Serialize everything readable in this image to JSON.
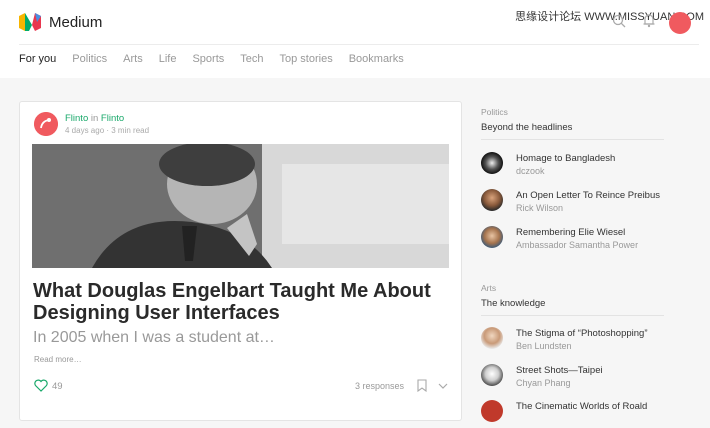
{
  "header": {
    "brand": "Medium",
    "watermark": "思缘设计论坛 WWW.MISSYUAN.COM",
    "nav": [
      "For you",
      "Politics",
      "Arts",
      "Life",
      "Sports",
      "Tech",
      "Top stories",
      "Bookmarks"
    ]
  },
  "post": {
    "author": "Flinto",
    "in_word": "in",
    "publication": "Flinto",
    "meta": "4 days ago · 3 min read",
    "title": "What Douglas Engelbart Taught Me About Designing User Interfaces",
    "subtitle": "In 2005 when I was a student at…",
    "read_more": "Read more…",
    "likes": "49",
    "responses": "3 responses"
  },
  "sidebar": {
    "sections": [
      {
        "category": "Politics",
        "title": "Beyond the headlines",
        "items": [
          {
            "title": "Homage to Bangladesh",
            "author": "dczook"
          },
          {
            "title": "An Open Letter To Reince Preibus",
            "author": "Rick Wilson"
          },
          {
            "title": "Remembering Elie Wiesel",
            "author": "Ambassador Samantha Power"
          }
        ]
      },
      {
        "category": "Arts",
        "title": "The knowledge",
        "items": [
          {
            "title": "The Stigma of “Photoshopping”",
            "author": "Ben Lundsten"
          },
          {
            "title": "Street Shots—Taipei",
            "author": "Chyan Phang"
          },
          {
            "title": "The Cinematic Worlds of Roald",
            "author": ""
          }
        ]
      }
    ]
  },
  "colors": {
    "accent": "#1aa96b",
    "avatar": "#f05a5f"
  }
}
